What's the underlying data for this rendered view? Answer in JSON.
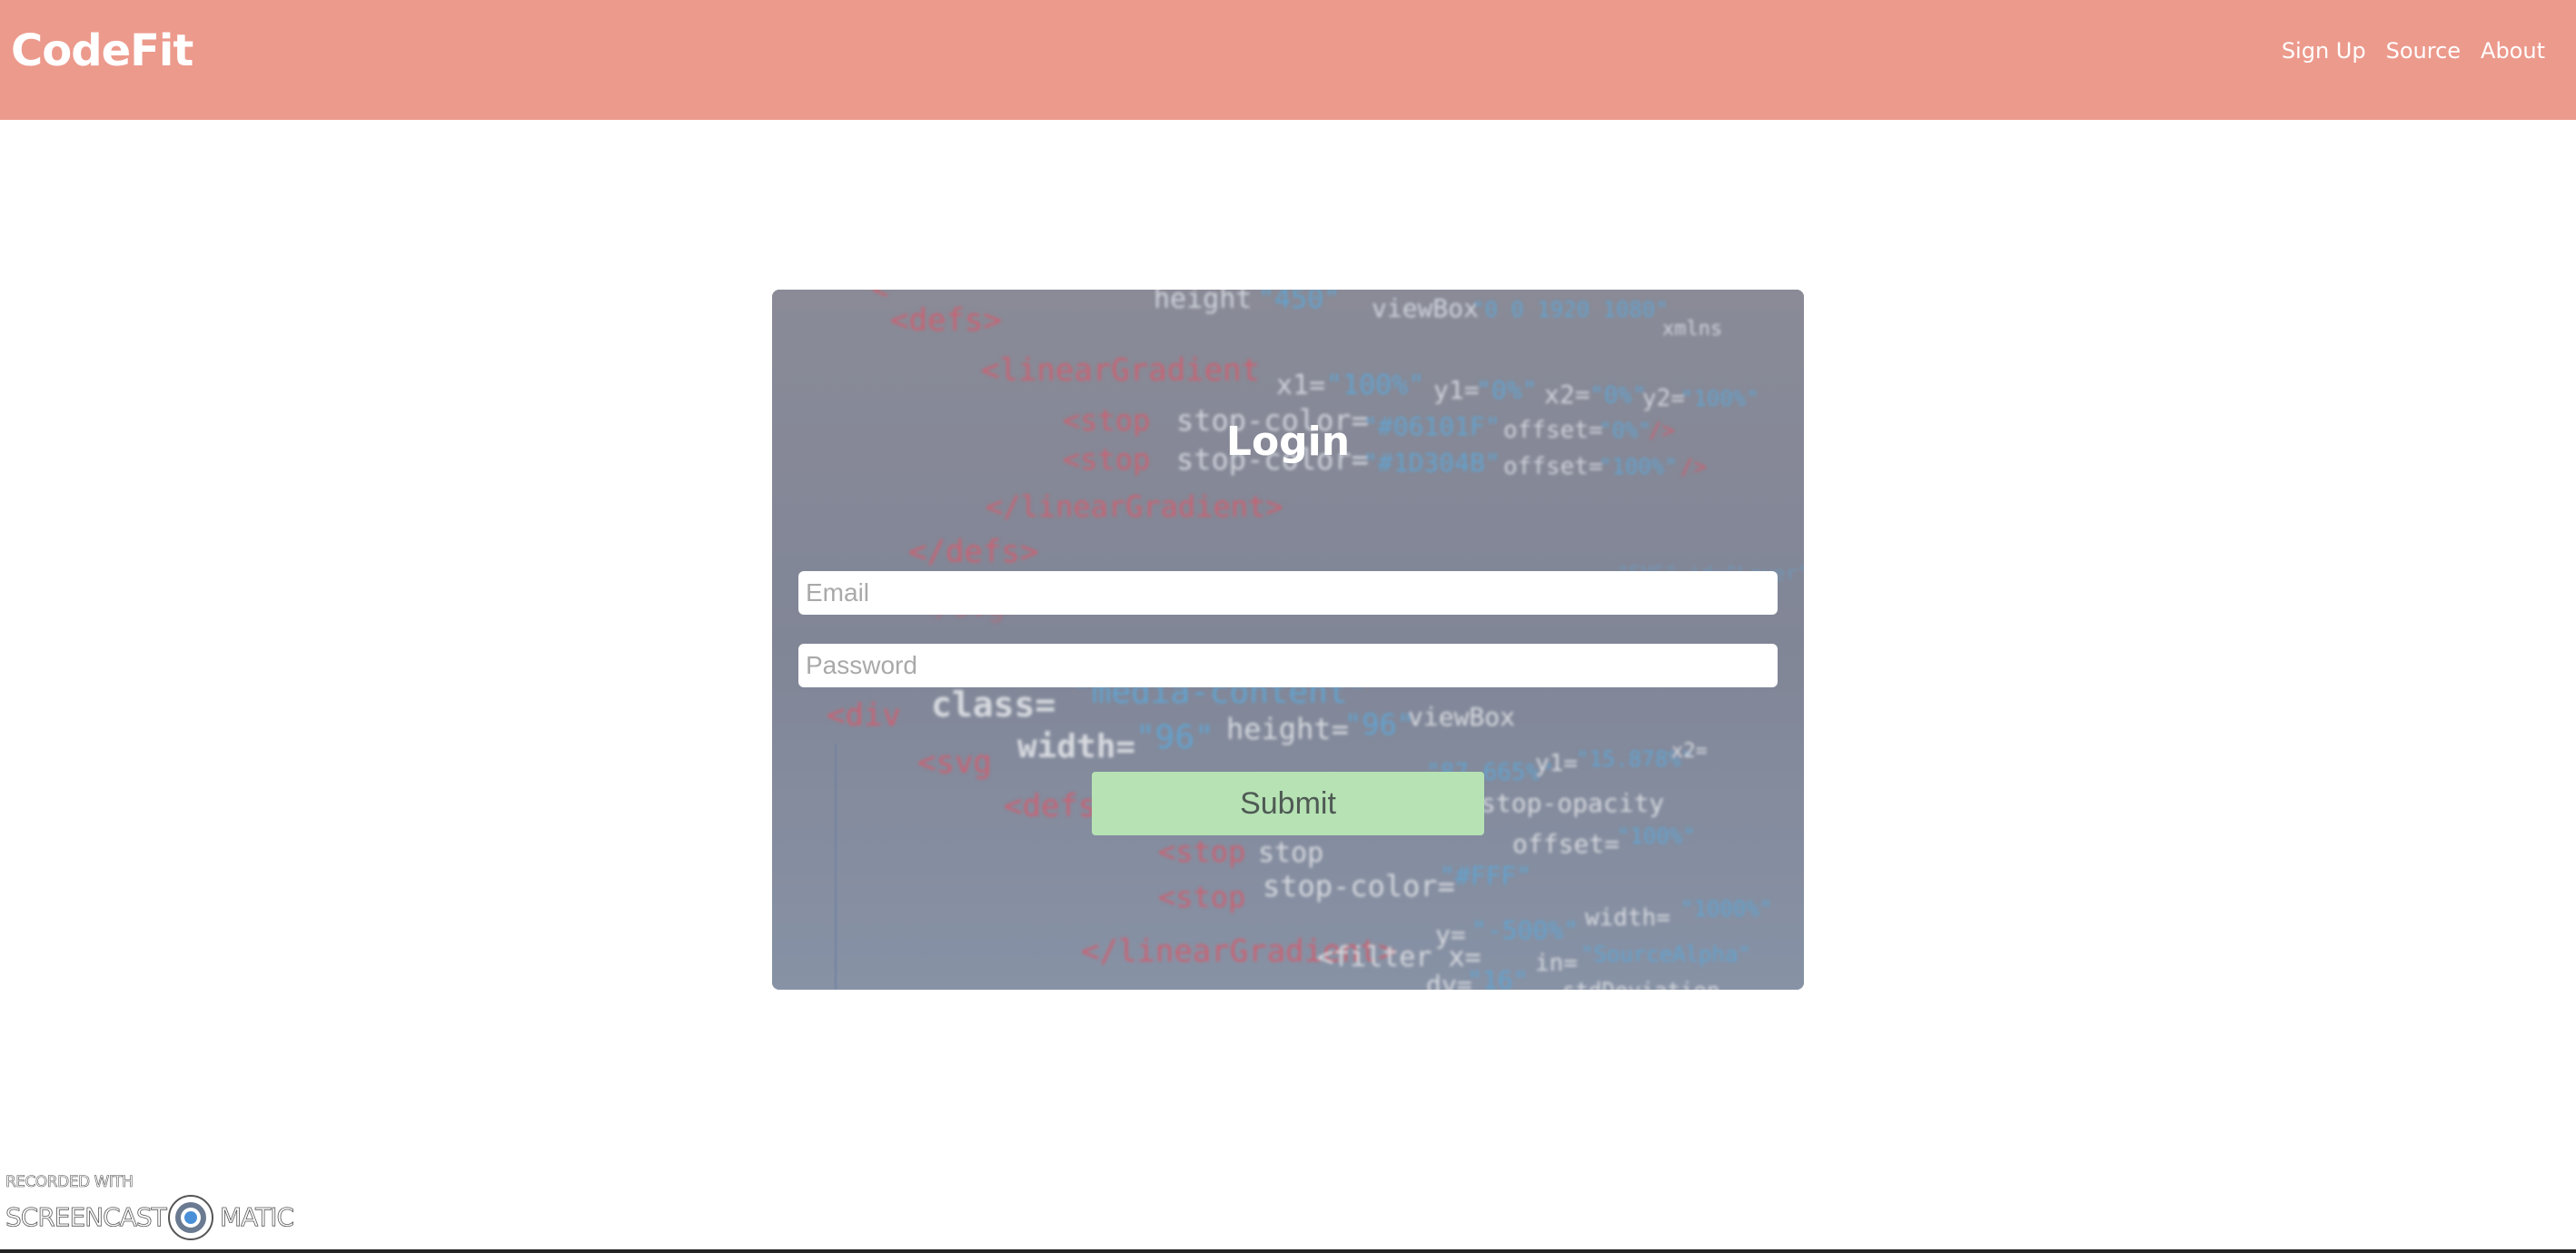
{
  "navbar": {
    "brand": "CodeFit",
    "links": [
      {
        "label": "Sign Up"
      },
      {
        "label": "Source"
      },
      {
        "label": "About"
      }
    ],
    "background": "#ec9a8c"
  },
  "login": {
    "title": "Login",
    "email_placeholder": "Email",
    "password_placeholder": "Password",
    "submit_label": "Submit",
    "submit_color": "#b6e2b4"
  },
  "watermark": {
    "line1": "RECORDED WITH",
    "left": "SCREENCAST",
    "right": "MATIC"
  }
}
